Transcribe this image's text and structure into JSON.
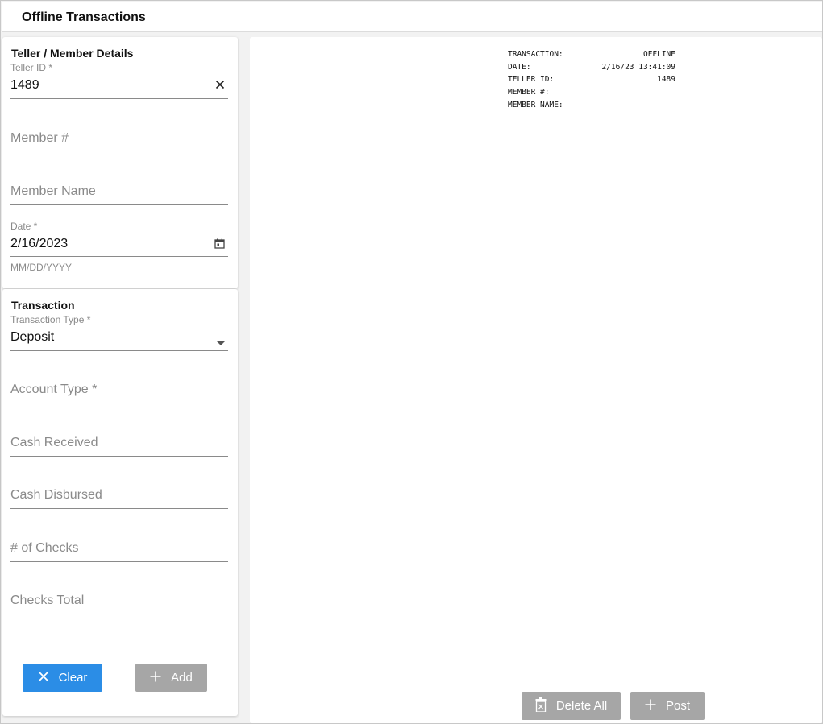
{
  "header": {
    "title": "Offline Transactions"
  },
  "teller_section": {
    "title": "Teller / Member Details",
    "teller_id": {
      "label": "Teller ID *",
      "value": "1489"
    },
    "member_number": {
      "placeholder": "Member #"
    },
    "member_name": {
      "placeholder": "Member Name"
    },
    "date": {
      "label": "Date *",
      "value": "2/16/2023",
      "helper": "MM/DD/YYYY"
    }
  },
  "transaction_section": {
    "title": "Transaction",
    "transaction_type": {
      "label": "Transaction Type *",
      "value": "Deposit"
    },
    "account_type": {
      "placeholder": "Account Type *"
    },
    "cash_received": {
      "placeholder": "Cash Received"
    },
    "cash_disbursed": {
      "placeholder": "Cash Disbursed"
    },
    "num_checks": {
      "placeholder": "# of Checks"
    },
    "checks_total": {
      "placeholder": "Checks Total"
    },
    "clear_label": "Clear",
    "add_label": "Add"
  },
  "receipt": {
    "rows": [
      {
        "label": "TRANSACTION:",
        "value": "OFFLINE"
      },
      {
        "label": "DATE:",
        "value": "2/16/23 13:41:09"
      },
      {
        "label": "TELLER ID:",
        "value": "1489"
      },
      {
        "label": "MEMBER #:",
        "value": ""
      },
      {
        "label": "MEMBER NAME:",
        "value": ""
      }
    ],
    "delete_all_label": "Delete All",
    "post_label": "Post"
  },
  "colors": {
    "primary": "#2b8de6",
    "disabled_button": "#a6a6a6"
  },
  "icons": [
    "clear-x-icon",
    "calendar-icon",
    "dropdown-arrow-icon",
    "close-icon",
    "plus-icon",
    "trash-icon"
  ]
}
